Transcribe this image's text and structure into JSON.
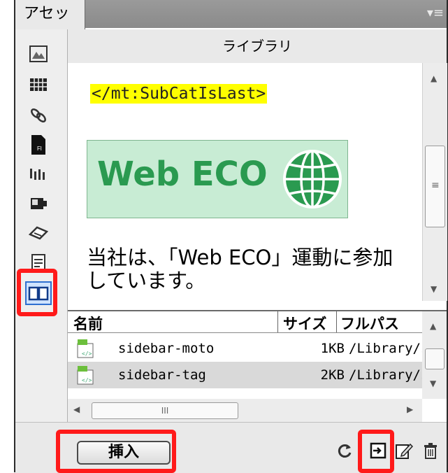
{
  "panel": {
    "tab_label": "アセット",
    "menu_glyph": "▾≡"
  },
  "categories": [
    {
      "name": "images",
      "icon": "image-icon"
    },
    {
      "name": "colors",
      "icon": "color-grid-icon"
    },
    {
      "name": "urls",
      "icon": "link-icon"
    },
    {
      "name": "flash",
      "icon": "flash-icon",
      "glyph": "Fl"
    },
    {
      "name": "shockwave",
      "icon": "shockwave-icon"
    },
    {
      "name": "movies",
      "icon": "movie-icon"
    },
    {
      "name": "scripts",
      "icon": "script-icon"
    },
    {
      "name": "templates",
      "icon": "template-icon"
    },
    {
      "name": "library",
      "icon": "library-icon",
      "selected": true
    }
  ],
  "preview": {
    "title": "ライブラリ",
    "code_line": "</mt:SubCatIsLast>",
    "logo_text": "Web ECO",
    "body_text": "当社は、「Web ECO」運動に参加しています。"
  },
  "list": {
    "columns": [
      "名前",
      "サイズ",
      "フルパス"
    ],
    "rows": [
      {
        "name": "sidebar-moto",
        "size": "1KB",
        "path": "/Library/s",
        "selected": false
      },
      {
        "name": "sidebar-tag",
        "size": "2KB",
        "path": "/Library/s",
        "selected": true
      }
    ],
    "hscroll_grip": "III",
    "vscroll_grip": "≡"
  },
  "toolbar": {
    "insert_label": "挿入",
    "refresh_icon": "refresh-icon",
    "new_item_icon": "new-library-item-icon",
    "edit_icon": "edit-icon",
    "delete_icon": "trash-icon"
  },
  "colors": {
    "highlight": "#ff1a1a",
    "code_highlight": "#ffff00",
    "logo_bg": "#c8ecd4",
    "logo_green": "#2a9a50"
  }
}
